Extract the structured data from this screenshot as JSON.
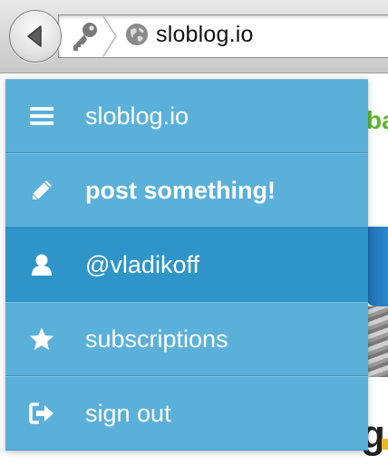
{
  "browser": {
    "url": "sloblog.io",
    "back_icon": "back-arrow-icon",
    "site_icon": "globe-icon",
    "security_icon": "key-icon"
  },
  "page_peek": {
    "green_text": "ba",
    "bottom_text": "g"
  },
  "menu": {
    "colors": {
      "item_bg": "#5ab0d9",
      "active_bg": "#2f95c8",
      "text": "#ffffff"
    },
    "items": [
      {
        "label": "sloblog.io",
        "icon": "hamburger-icon",
        "active": false,
        "bold": false
      },
      {
        "label": "post something!",
        "icon": "pencil-icon",
        "active": false,
        "bold": true
      },
      {
        "label": "@vladikoff",
        "icon": "user-icon",
        "active": true,
        "bold": false
      },
      {
        "label": "subscriptions",
        "icon": "star-icon",
        "active": false,
        "bold": false
      },
      {
        "label": "sign out",
        "icon": "sign-out-icon",
        "active": false,
        "bold": false
      }
    ]
  }
}
